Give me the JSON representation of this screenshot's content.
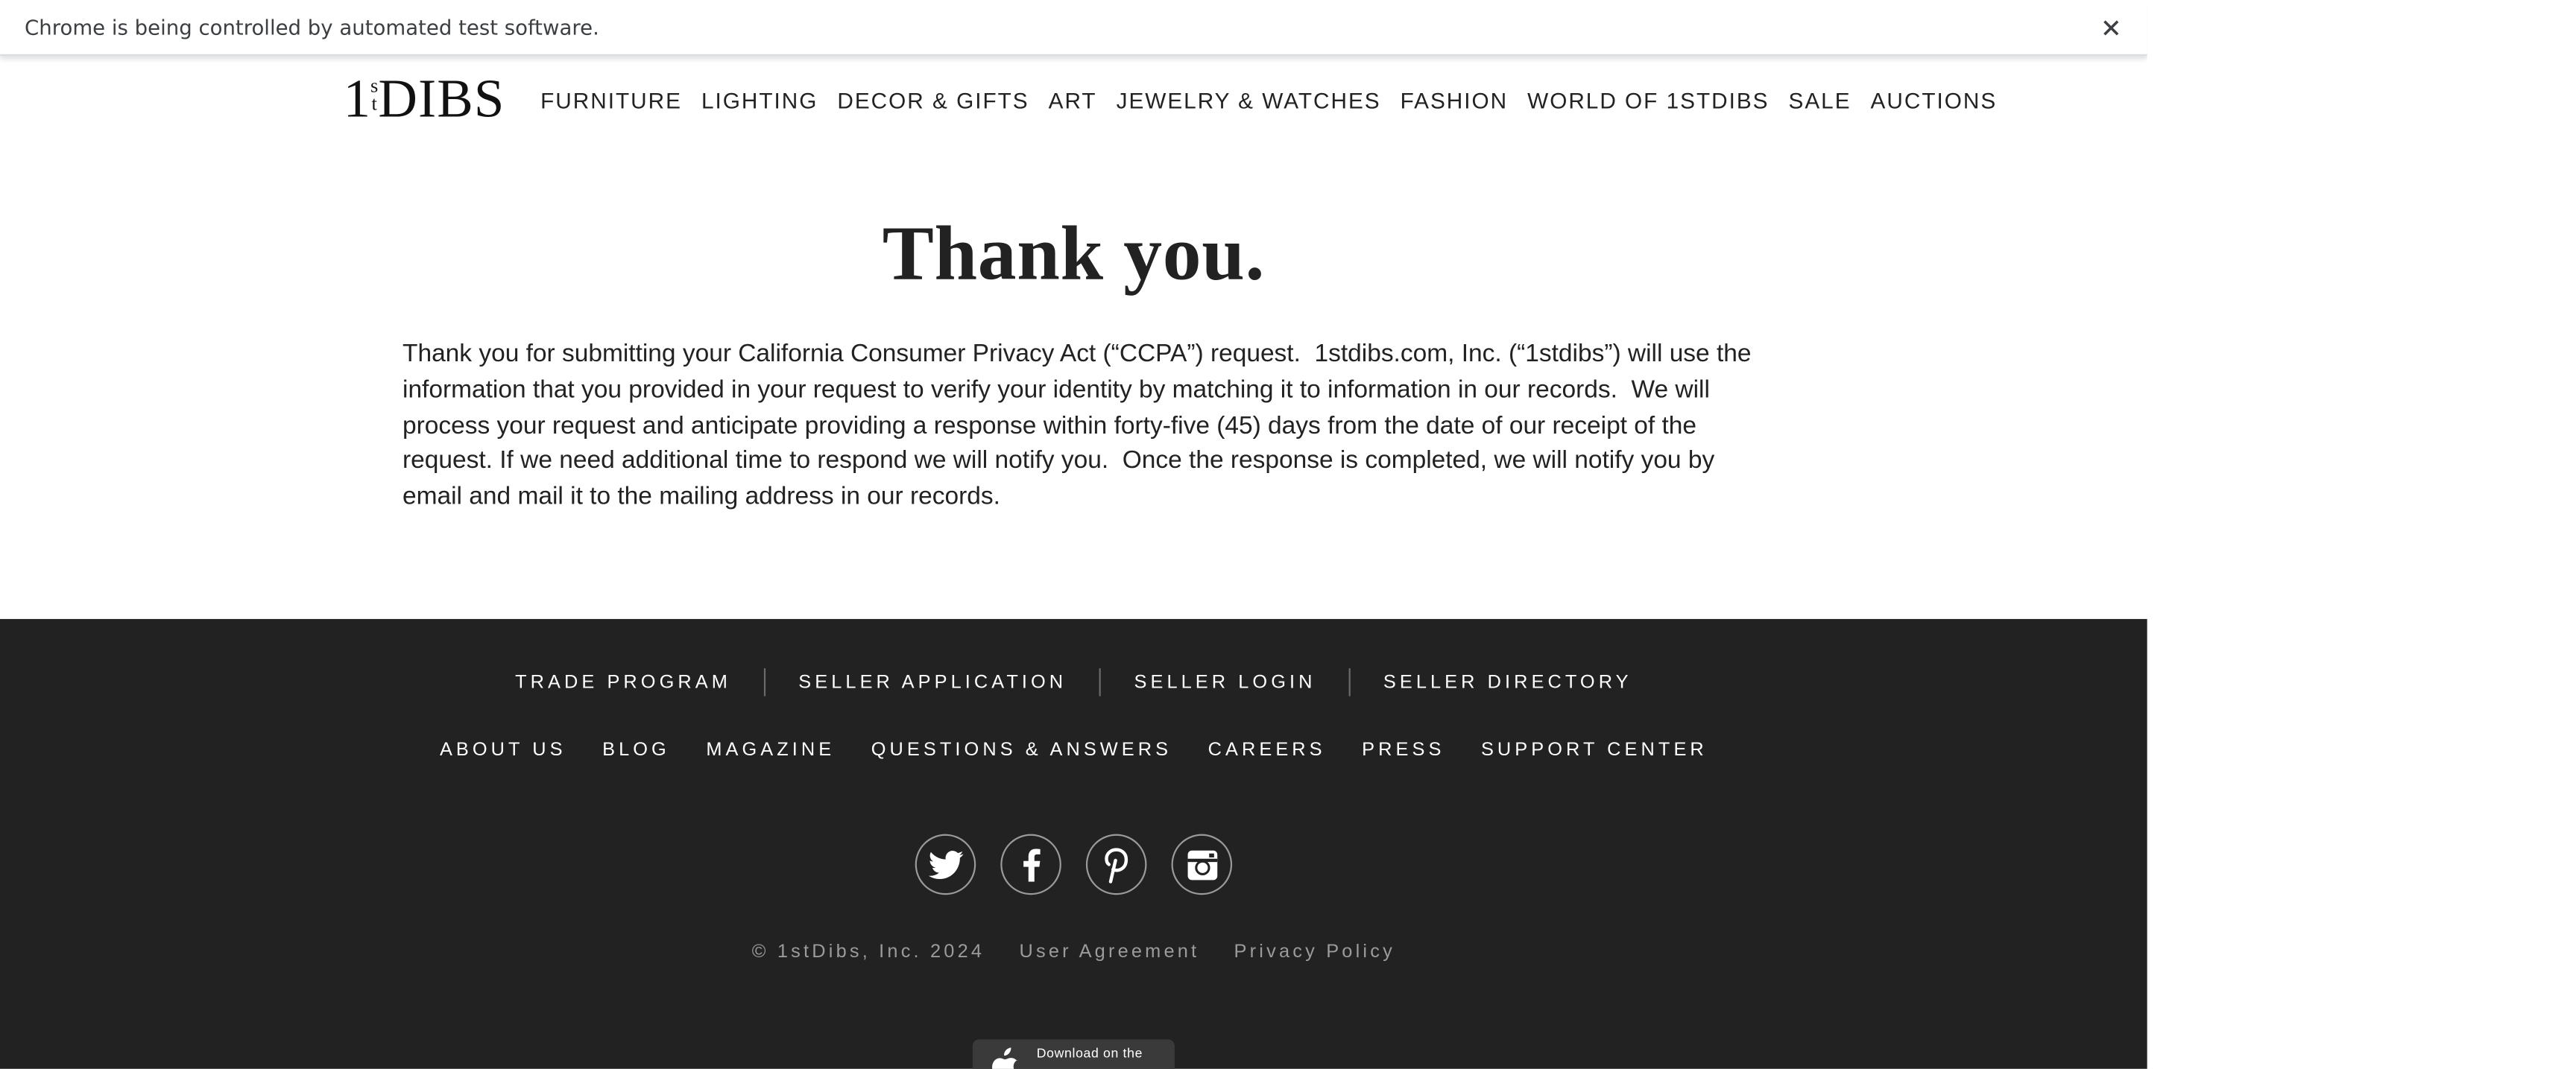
{
  "browser": {
    "infobar_text": "Chrome is being controlled by automated test software.",
    "close_icon": "close-icon"
  },
  "header": {
    "logo": {
      "one": "1",
      "s": "s",
      "t": "t",
      "dibs": "DIBS"
    },
    "nav": [
      "FURNITURE",
      "LIGHTING",
      "DECOR & GIFTS",
      "ART",
      "JEWELRY & WATCHES",
      "FASHION",
      "WORLD OF 1STDIBS",
      "SALE",
      "AUCTIONS"
    ]
  },
  "main": {
    "heading": "Thank you.",
    "body": "Thank you for submitting your California Consumer Privacy Act (“CCPA”) request.  1stdibs.com, Inc. (“1stdibs”) will use the information that you provided in your request to verify your identity by matching it to information in our records.  We will process your request and anticipate providing a response within forty-five (45) days from the date of our receipt of the request. If we need additional time to respond we will notify you.  Once the response is completed, we will notify you by email and mail it to the mailing address in our records."
  },
  "footer": {
    "row1": [
      "TRADE PROGRAM",
      "SELLER APPLICATION",
      "SELLER LOGIN",
      "SELLER DIRECTORY"
    ],
    "row2": [
      "ABOUT US",
      "BLOG",
      "MAGAZINE",
      "QUESTIONS & ANSWERS",
      "CAREERS",
      "PRESS",
      "SUPPORT CENTER"
    ],
    "social_icons": [
      "twitter-icon",
      "facebook-icon",
      "pinterest-icon",
      "instagram-icon"
    ],
    "copyright": "© 1stDibs, Inc. 2024",
    "user_agreement": "User Agreement",
    "privacy_policy": "Privacy Policy",
    "app_store_label": "Download on the"
  },
  "colors": {
    "footer_bg": "#222222",
    "text": "#222222",
    "footer_text": "#ffffff",
    "legal_text": "#9b9b9b"
  }
}
